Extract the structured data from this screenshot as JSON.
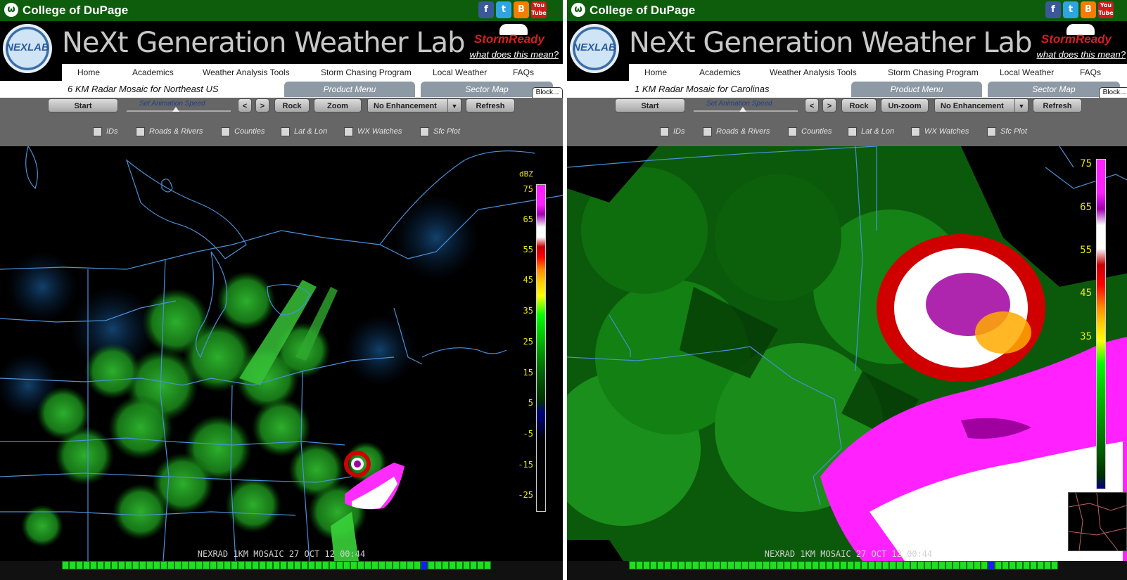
{
  "site": {
    "college_name": "College of DuPage",
    "lab_title": "NeXt Generation Weather Lab",
    "lab_logo_text": "NEXLAB",
    "storm_ready": "StormReady",
    "what_does_this_mean": "what does this mean?",
    "social": [
      {
        "name": "facebook",
        "glyph": "f",
        "color": "#3b5998"
      },
      {
        "name": "twitter",
        "glyph": "t",
        "color": "#2fa4e0"
      },
      {
        "name": "blogger",
        "glyph": "B",
        "color": "#f57d00"
      },
      {
        "name": "youtube",
        "glyph": "You Tube",
        "color": "#d11b1b"
      }
    ]
  },
  "nav": [
    "Home",
    "Academics",
    "Weather Analysis Tools",
    "Storm Chasing Program",
    "Local Weather",
    "FAQs"
  ],
  "tabs": {
    "product_menu": "Product Menu",
    "sector_map": "Sector Map",
    "block": "Block..."
  },
  "controls": {
    "start": "Start",
    "speed_label": "Set Animation Speed",
    "prev": "<",
    "next": ">",
    "rock": "Rock",
    "enhancement": "No Enhancement",
    "refresh": "Refresh",
    "checkboxes": [
      "IDs",
      "Roads & Rivers",
      "Counties",
      "Lat & Lon",
      "WX Watches",
      "Sfc Plot"
    ]
  },
  "left": {
    "page_title": "6 KM Radar Mosaic for Northeast US",
    "zoom_label": "Zoom",
    "footer": "NEXRAD 1KM MOSAIC 27 OCT 12  00:44",
    "scale_unit": "dBZ",
    "scale_values": [
      "75",
      "65",
      "55",
      "45",
      "35",
      "25",
      "15",
      "5",
      "-5",
      "-15",
      "-25"
    ]
  },
  "right": {
    "page_title": "1 KM Radar Mosaic for Carolinas",
    "zoom_label": "Un-zoom",
    "footer": "NEXRAD 1KM MOSAIC 27 OCT 12  00:44",
    "scale_values": [
      "75",
      "65",
      "55",
      "45",
      "35"
    ]
  },
  "colors": {
    "college_green": "#0d5d0d",
    "radar_green": "#1a8f1a",
    "radar_white": "#ffffff",
    "radar_magenta": "#ff00ff",
    "radar_red": "#d00000",
    "map_lines": "#4a90d9"
  }
}
